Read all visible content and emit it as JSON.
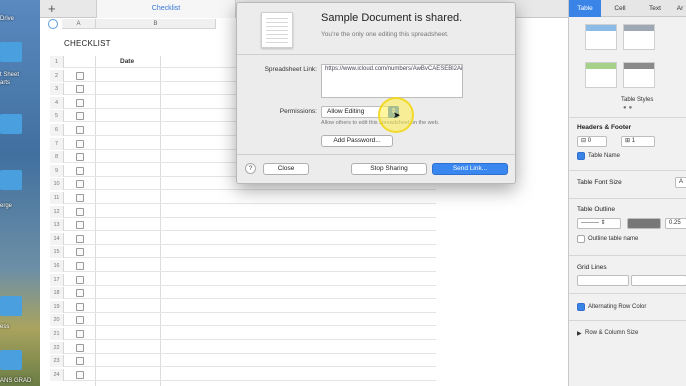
{
  "desktop": {
    "labels": [
      "Drive",
      "t Sheet",
      "arts",
      "erge",
      "ess",
      "ANS GRAD"
    ]
  },
  "sheet": {
    "tab_label": "Checklist",
    "columns": [
      "A",
      "B"
    ],
    "title": "CHECKLIST",
    "date_header": "Date",
    "row_numbers": [
      "1",
      "2",
      "3",
      "4",
      "5",
      "6",
      "7",
      "8",
      "9",
      "10",
      "11",
      "12",
      "13",
      "14",
      "15",
      "16",
      "17",
      "18",
      "19",
      "20",
      "21",
      "22",
      "23",
      "24"
    ]
  },
  "dialog": {
    "title": "Sample Document is shared.",
    "subtitle": "You’re the only one editing this spreadsheet.",
    "link_label": "Spreadsheet Link:",
    "link_text": "https://www.icloud.com/numbers/AwBvCAESEBl2AiKugJCaRlXIGzxIbdoaPZIWGL4D5_tKSQz9XHX285GcMhCDlB_caO4u9kmYezBLV2QSaipNgmHsAea7CV57e_A2JQ",
    "permissions_label": "Permissions:",
    "permissions_value": "Allow Editing",
    "permissions_hint": "Allow others to edit this spreadsheet on the web.",
    "add_password": "Add Password...",
    "help": "?",
    "close": "Close",
    "stop_sharing": "Stop Sharing",
    "send_link": "Send Link..."
  },
  "inspector": {
    "tabs": [
      "Table",
      "Cell",
      "Text",
      "Ar"
    ],
    "table_styles": "Table Styles",
    "headers_footer": "Headers & Footer",
    "header_rows": "0",
    "header_cols": "1",
    "table_name": "Table Name",
    "table_font_size": "Table Font Size",
    "font_btn": "A",
    "table_outline": "Table Outline",
    "outline_value": "0.25",
    "outline_table_name": "Outline table name",
    "grid_lines": "Grid Lines",
    "alternating_row_color": "Alternating Row Color",
    "row_column_size": "Row & Column Size",
    "accent": "#3a84e8"
  }
}
